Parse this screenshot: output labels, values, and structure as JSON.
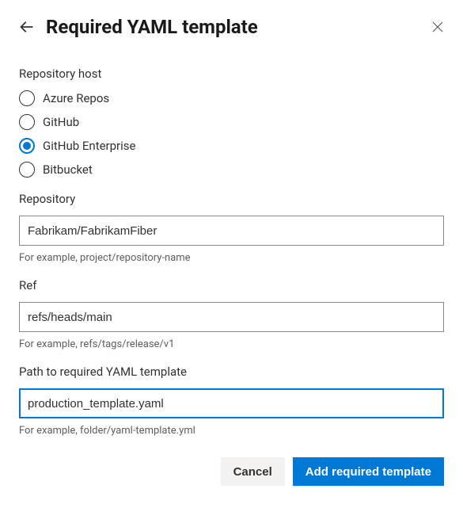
{
  "header": {
    "title": "Required YAML template"
  },
  "host": {
    "label": "Repository host",
    "options": [
      {
        "label": "Azure Repos",
        "selected": false
      },
      {
        "label": "GitHub",
        "selected": false
      },
      {
        "label": "GitHub Enterprise",
        "selected": true
      },
      {
        "label": "Bitbucket",
        "selected": false
      }
    ]
  },
  "repository": {
    "label": "Repository",
    "value": "Fabrikam/FabrikamFiber",
    "helper": "For example, project/repository-name"
  },
  "ref": {
    "label": "Ref",
    "value": "refs/heads/main",
    "helper": "For example, refs/tags/release/v1"
  },
  "path": {
    "label": "Path to required YAML template",
    "value": "production_template.yaml",
    "helper": "For example, folder/yaml-template.yml"
  },
  "footer": {
    "cancel": "Cancel",
    "submit": "Add required template"
  }
}
